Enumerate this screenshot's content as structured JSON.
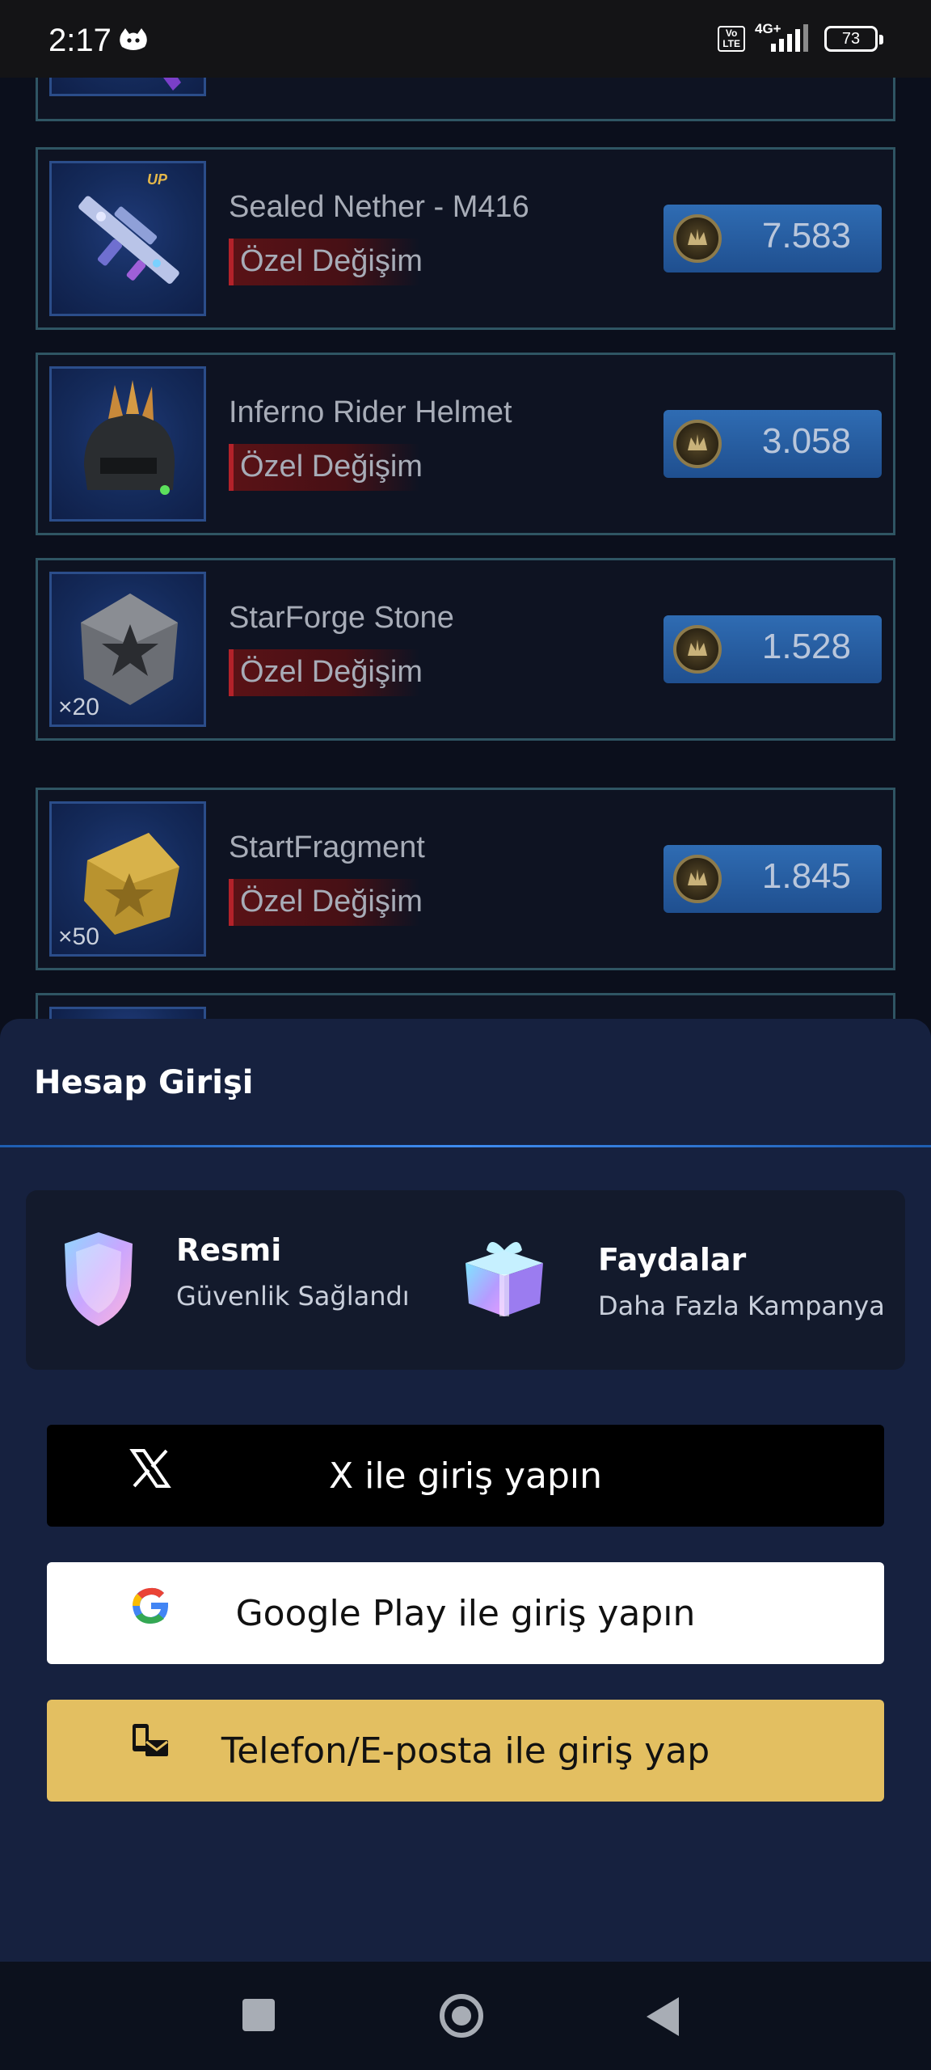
{
  "status_bar": {
    "time": "2:17",
    "volte": "Vo\nLTE",
    "network": "4G+",
    "battery": "73"
  },
  "items": [
    {
      "name": "Sealed Nether - M416",
      "tag": "Özel Değişim",
      "price": "7.583",
      "quantity": "",
      "badge": "UP"
    },
    {
      "name": "Inferno Rider Helmet",
      "tag": "Özel Değişim",
      "price": "3.058",
      "quantity": ""
    },
    {
      "name": "StarForge Stone",
      "tag": "Özel Değişim",
      "price": "1.528",
      "quantity": "×20"
    },
    {
      "name": "StartFragment",
      "tag": "Özel Değişim",
      "price": "1.845",
      "quantity": "×50"
    }
  ],
  "login_sheet": {
    "title": "Hesap Girişi",
    "features": [
      {
        "title": "Resmi",
        "subtitle": "Güvenlik Sağlandı",
        "icon": "shield-icon"
      },
      {
        "title": "Faydalar",
        "subtitle": "Daha Fazla Kampanya",
        "icon": "gift-icon"
      }
    ],
    "buttons": {
      "x": "X ile giriş yapın",
      "google": "Google Play ile giriş yapın",
      "phone": "Telefon/E-posta ile giriş yap"
    }
  },
  "colors": {
    "background": "#0b0f1c",
    "sheet": "#16213f",
    "price_button": "#2f6cb3",
    "tag_red": "#b3222a",
    "phone_button": "#e3bf61"
  }
}
